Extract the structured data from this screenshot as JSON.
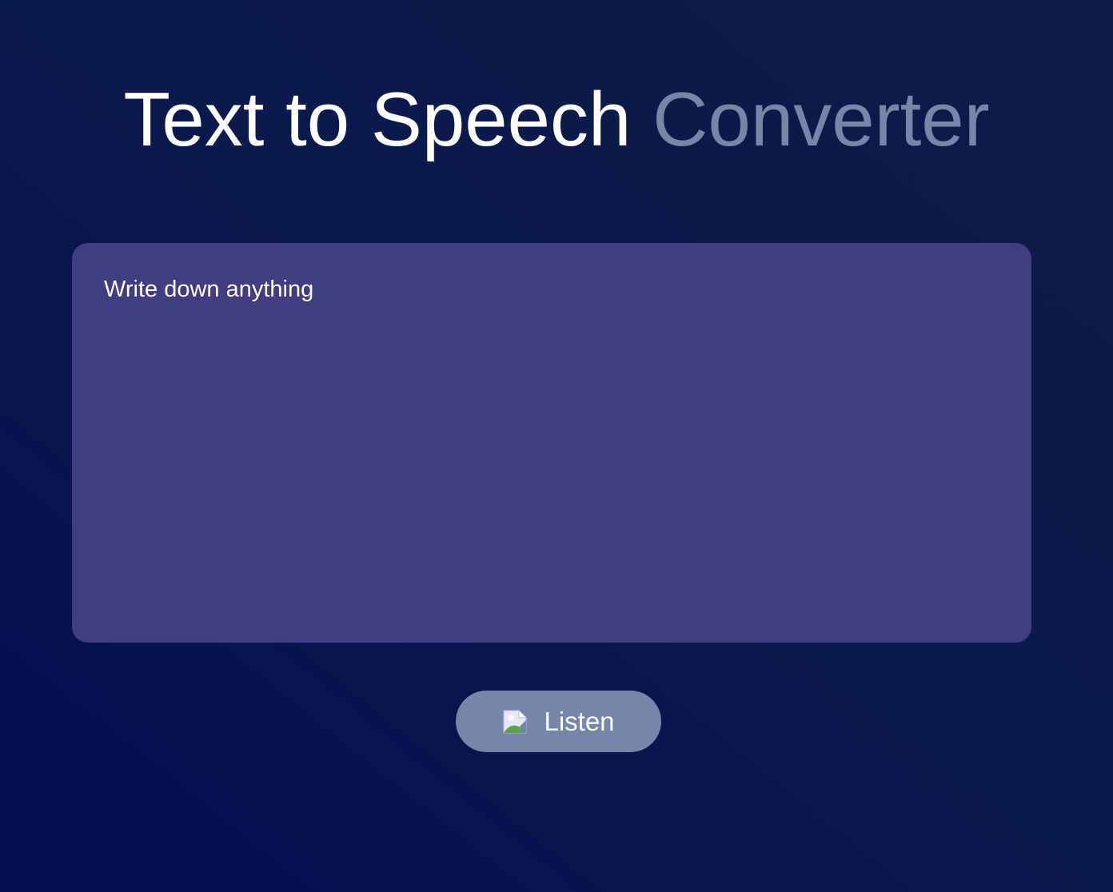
{
  "header": {
    "title_main": "Text to Speech",
    "title_accent": "Converter"
  },
  "editor": {
    "placeholder": "Write down anything",
    "value": ""
  },
  "actions": {
    "listen_label": "Listen",
    "listen_icon": "broken-image-icon"
  },
  "colors": {
    "background_start": "#050d51",
    "background_end": "#0d1b47",
    "title_main": "#ffffff",
    "title_accent": "#7586a8",
    "editor_background": "#403e7e",
    "button_background": "#7586a8"
  }
}
